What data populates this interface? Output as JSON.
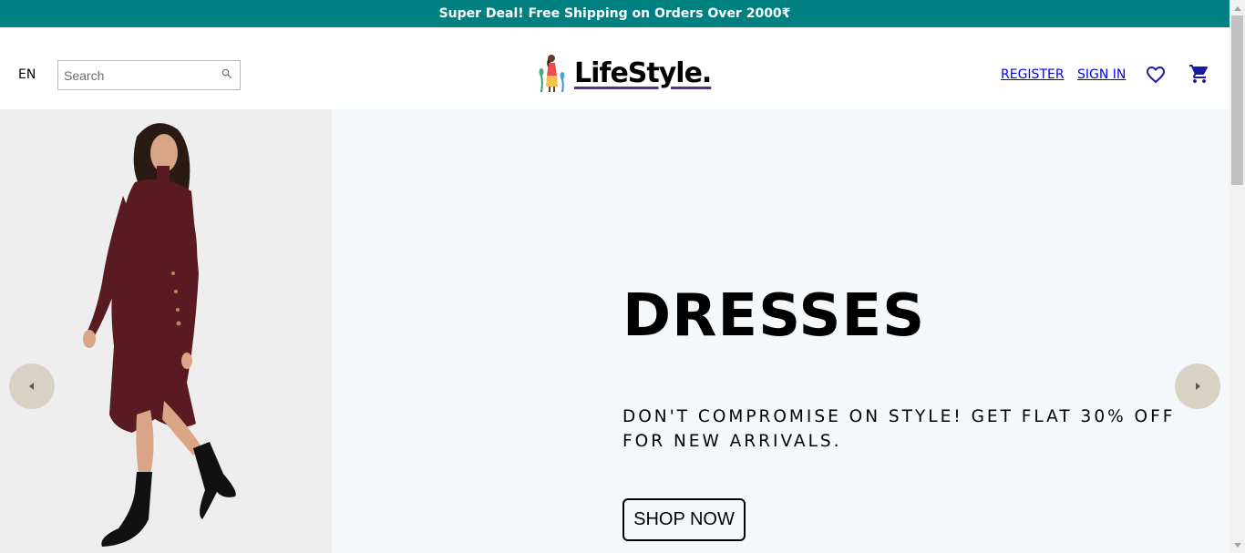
{
  "announcement": {
    "text": "Super Deal! Free Shipping on Orders Over 2000₹"
  },
  "navbar": {
    "language": "EN",
    "search": {
      "placeholder": "Search",
      "value": ""
    },
    "logo_text": "LifeStyle.",
    "links": {
      "register": "REGISTER",
      "signin": "SIGN IN"
    },
    "icons": {
      "search": "search-icon",
      "wishlist": "heart-icon",
      "cart": "cart-icon"
    }
  },
  "hero": {
    "title": "DRESSES",
    "description": "DON'T COMPROMISE ON STYLE! GET FLAT 30% OFF FOR NEW ARRIVALS.",
    "button_label": "SHOP NOW",
    "background_color": "#f4f8fa"
  },
  "colors": {
    "announcement_bg": "#008080",
    "link": "#0000ee",
    "logo_underline": "#5b2c91",
    "arrow_bg": "#d8d2c4",
    "dress": "#5a1a22"
  }
}
